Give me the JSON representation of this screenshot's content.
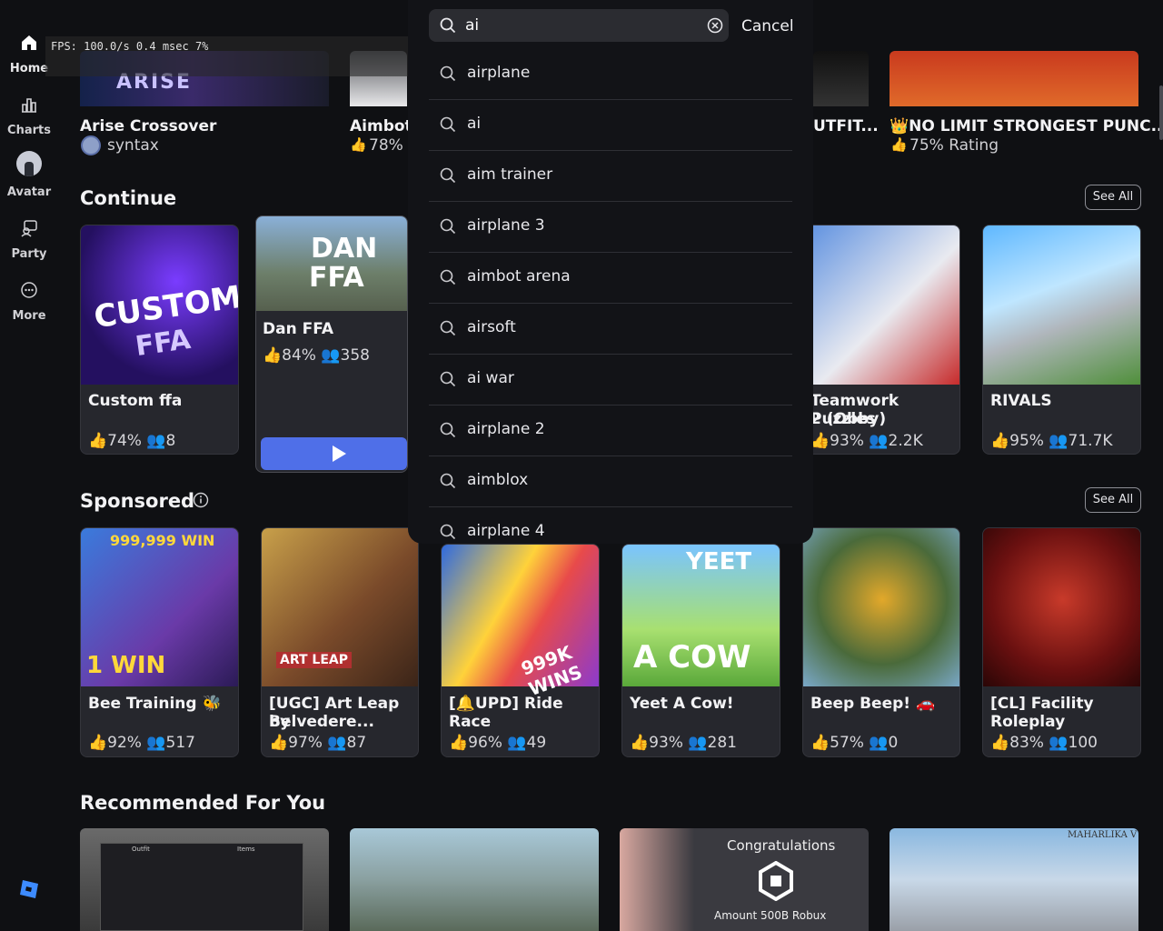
{
  "nav": {
    "items": [
      {
        "label": "Home"
      },
      {
        "label": "Charts"
      },
      {
        "label": "Avatar"
      },
      {
        "label": "Party"
      },
      {
        "label": "More"
      }
    ]
  },
  "fps": "FPS: 100.0/s 0.4 msec 7%",
  "top_row": [
    {
      "title": "Arise Crossover",
      "sub": "syntax"
    },
    {
      "title": "Aimbot",
      "sub": "78% |"
    },
    {
      "title": "UTFIT...",
      "sub": ""
    },
    {
      "title": "👑NO LIMIT STRONGEST PUNC...",
      "sub": "75% Rating"
    }
  ],
  "continue": {
    "title": "Continue",
    "see_all": "See All",
    "cards": [
      {
        "title": "Custom ffa",
        "rating": "74%",
        "players": "8"
      },
      {
        "title": "Dan FFA",
        "rating": "84%",
        "players": "358"
      },
      {
        "title": "Teamwork Puzzles 2 (Obby)",
        "line1": "Teamwork Puzzles",
        "line2": "2 (Obby)",
        "rating": "93%",
        "players": "2.2K"
      },
      {
        "title": "RIVALS",
        "rating": "95%",
        "players": "71.7K"
      }
    ]
  },
  "sponsored": {
    "title": "Sponsored",
    "see_all": "See All",
    "cards": [
      {
        "line1": "Bee Training 🐝",
        "line2": "",
        "rating": "92%",
        "players": "517"
      },
      {
        "line1": "[UGC] Art Leap by",
        "line2": "Belvedere...",
        "rating": "97%",
        "players": "87"
      },
      {
        "line1": "[🔔UPD] Ride",
        "line2": "Race",
        "rating": "96%",
        "players": "49"
      },
      {
        "line1": "Yeet A Cow!",
        "line2": "",
        "rating": "93%",
        "players": "281"
      },
      {
        "line1": "Beep Beep! 🚗",
        "line2": "",
        "rating": "57%",
        "players": "0"
      },
      {
        "line1": "[CL] Facility",
        "line2": "Roleplay",
        "rating": "83%",
        "players": "100"
      }
    ]
  },
  "recommended": {
    "title": "Recommended For You",
    "thumb_texts": {
      "congrats": "Congratulations",
      "amount": "Amount 500B Robux",
      "outfit": "Outfit",
      "items": "Items",
      "maharlika": "MAHARLIKA V"
    }
  },
  "thumb_texts": {
    "arise": "ARISE",
    "custom1": "CUSTOM",
    "custom2": "FFA",
    "dan1": "DAN",
    "dan2": "FFA",
    "bee_top": "999,999 WIN",
    "bee_bottom": "1 WIN",
    "artleap": "ART LEAP",
    "wins": "999K WINS",
    "yeet": "YEET",
    "cow": "A COW"
  },
  "search": {
    "value": "ai",
    "cancel": "Cancel",
    "suggestions": [
      "airplane",
      "ai",
      "aim trainer",
      "airplane 3",
      "aimbot arena",
      "airsoft",
      "ai war",
      "airplane 2",
      "aimblox",
      "airplane 4"
    ]
  },
  "colors": {
    "accent": "#4f6fe8",
    "background": "#0f1013",
    "card": "#26272d"
  }
}
